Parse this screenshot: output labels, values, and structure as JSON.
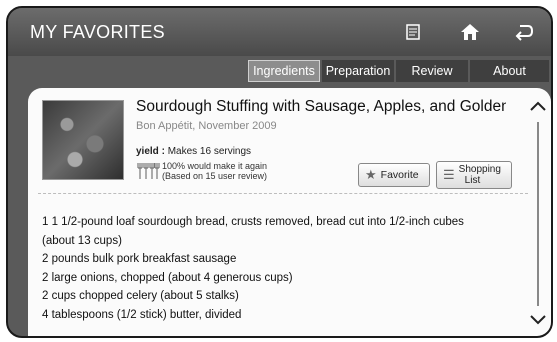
{
  "header": {
    "title": "MY FAVORITES",
    "icons": [
      "notepad-icon",
      "home-icon",
      "back-icon"
    ]
  },
  "tabs": [
    {
      "label": "Ingredients",
      "active": true
    },
    {
      "label": "Preparation",
      "active": false
    },
    {
      "label": "Review",
      "active": false
    },
    {
      "label": "About",
      "active": false
    }
  ],
  "recipe": {
    "title": "Sourdough Stuffing with Sausage, Apples, and Golden Rai…",
    "source": "Bon Appétit, November 2009",
    "yield_label": "yield :",
    "yield_value": "Makes 16 servings",
    "rating_line1": "100% would make it again",
    "rating_line2": "(Based on 15 user review)"
  },
  "buttons": {
    "favorite": "Favorite",
    "shopping_line1": "Shopping",
    "shopping_line2": "List"
  },
  "ingredients": [
    "1 1 1/2-pound loaf sourdough bread, crusts removed, bread cut into 1/2-inch cubes",
    "(about 13 cups)",
    "2 pounds bulk pork breakfast sausage",
    "2 large onions, chopped (about 4 generous cups)",
    "2 cups chopped celery (about 5 stalks)",
    "4 tablespoons (1/2 stick) butter, divided"
  ],
  "colors": {
    "frame_bg": "#5a5a5a",
    "active_tab": "#8d8d8d",
    "content_bg": "#fbfbfb"
  }
}
